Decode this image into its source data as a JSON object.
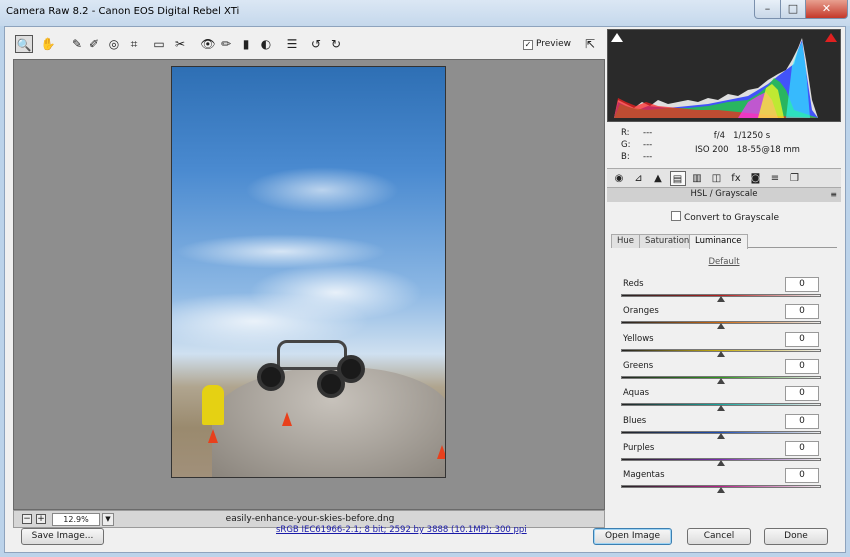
{
  "window": {
    "title": "Camera Raw 8.2  -  Canon EOS Digital Rebel XTi",
    "minimize": "–",
    "maximize": "□",
    "close": "✕"
  },
  "toolbar": {
    "tools": [
      {
        "name": "zoom-tool-icon",
        "glyph": "🔍"
      },
      {
        "name": "hand-tool-icon",
        "glyph": "✋"
      },
      {
        "name": "white-balance-tool-icon",
        "glyph": "✎"
      },
      {
        "name": "color-sampler-tool-icon",
        "glyph": "✐"
      },
      {
        "name": "targeted-adjustment-tool-icon",
        "glyph": "◎"
      },
      {
        "name": "crop-tool-icon",
        "glyph": "⌗"
      },
      {
        "name": "straighten-tool-icon",
        "glyph": "▭"
      },
      {
        "name": "spot-removal-tool-icon",
        "glyph": "✂"
      },
      {
        "name": "red-eye-removal-tool-icon",
        "glyph": "👁"
      },
      {
        "name": "adjustment-brush-icon",
        "glyph": "✏"
      },
      {
        "name": "graduated-filter-icon",
        "glyph": "▮"
      },
      {
        "name": "radial-filter-icon",
        "glyph": "◐"
      },
      {
        "name": "preferences-icon",
        "glyph": "☰"
      },
      {
        "name": "rotate-left-icon",
        "glyph": "↺"
      },
      {
        "name": "rotate-right-icon",
        "glyph": "↻"
      }
    ],
    "preview_label": "Preview",
    "preview_checked": "✓",
    "fullscreen_glyph": "⇱"
  },
  "status": {
    "zoom_out": "−",
    "zoom_in": "+",
    "zoom_value": "12.9%",
    "zoom_dropdown": "▼",
    "filename": "easily-enhance-your-skies-before.dng"
  },
  "info": {
    "rgb_labels": [
      "R:",
      "G:",
      "B:"
    ],
    "rgb_values": [
      "---",
      "---",
      "---"
    ],
    "aperture": "f/4",
    "shutter": "1/1250 s",
    "iso": "ISO 200",
    "lens": "18-55@18 mm"
  },
  "panel_tabs": [
    {
      "name": "basic-tab-icon",
      "glyph": "◉"
    },
    {
      "name": "tone-curve-tab-icon",
      "glyph": "⊿"
    },
    {
      "name": "detail-tab-icon",
      "glyph": "▲"
    },
    {
      "name": "hsl-grayscale-tab-icon",
      "glyph": "▤"
    },
    {
      "name": "split-toning-tab-icon",
      "glyph": "▥"
    },
    {
      "name": "lens-corrections-tab-icon",
      "glyph": "◫"
    },
    {
      "name": "effects-tab-icon",
      "glyph": "fx"
    },
    {
      "name": "camera-calibration-tab-icon",
      "glyph": "◙"
    },
    {
      "name": "presets-tab-icon",
      "glyph": "≡"
    },
    {
      "name": "snapshots-tab-icon",
      "glyph": "❐"
    }
  ],
  "panel": {
    "title": "HSL / Grayscale",
    "menu_glyph": "≡",
    "grayscale_label": "Convert to Grayscale",
    "subtabs": [
      "Hue",
      "Saturation",
      "Luminance"
    ],
    "default_link": "Default",
    "sliders": [
      {
        "label": "Reds",
        "value": "0",
        "color": "#b82020"
      },
      {
        "label": "Oranges",
        "value": "0",
        "color": "#d06a10"
      },
      {
        "label": "Yellows",
        "value": "0",
        "color": "#c9b010"
      },
      {
        "label": "Greens",
        "value": "0",
        "color": "#2f9a1c"
      },
      {
        "label": "Aquas",
        "value": "0",
        "color": "#18a8a0"
      },
      {
        "label": "Blues",
        "value": "0",
        "color": "#1d4fb8"
      },
      {
        "label": "Purples",
        "value": "0",
        "color": "#7a2cb0"
      },
      {
        "label": "Magentas",
        "value": "0",
        "color": "#b8208a"
      }
    ]
  },
  "bottom": {
    "save_label": "Save Image...",
    "workflow_link": "sRGB IEC61966-2.1; 8 bit; 2592 by 3888 (10.1MP); 300 ppi",
    "open_label": "Open Image",
    "cancel_label": "Cancel",
    "done_label": "Done"
  }
}
